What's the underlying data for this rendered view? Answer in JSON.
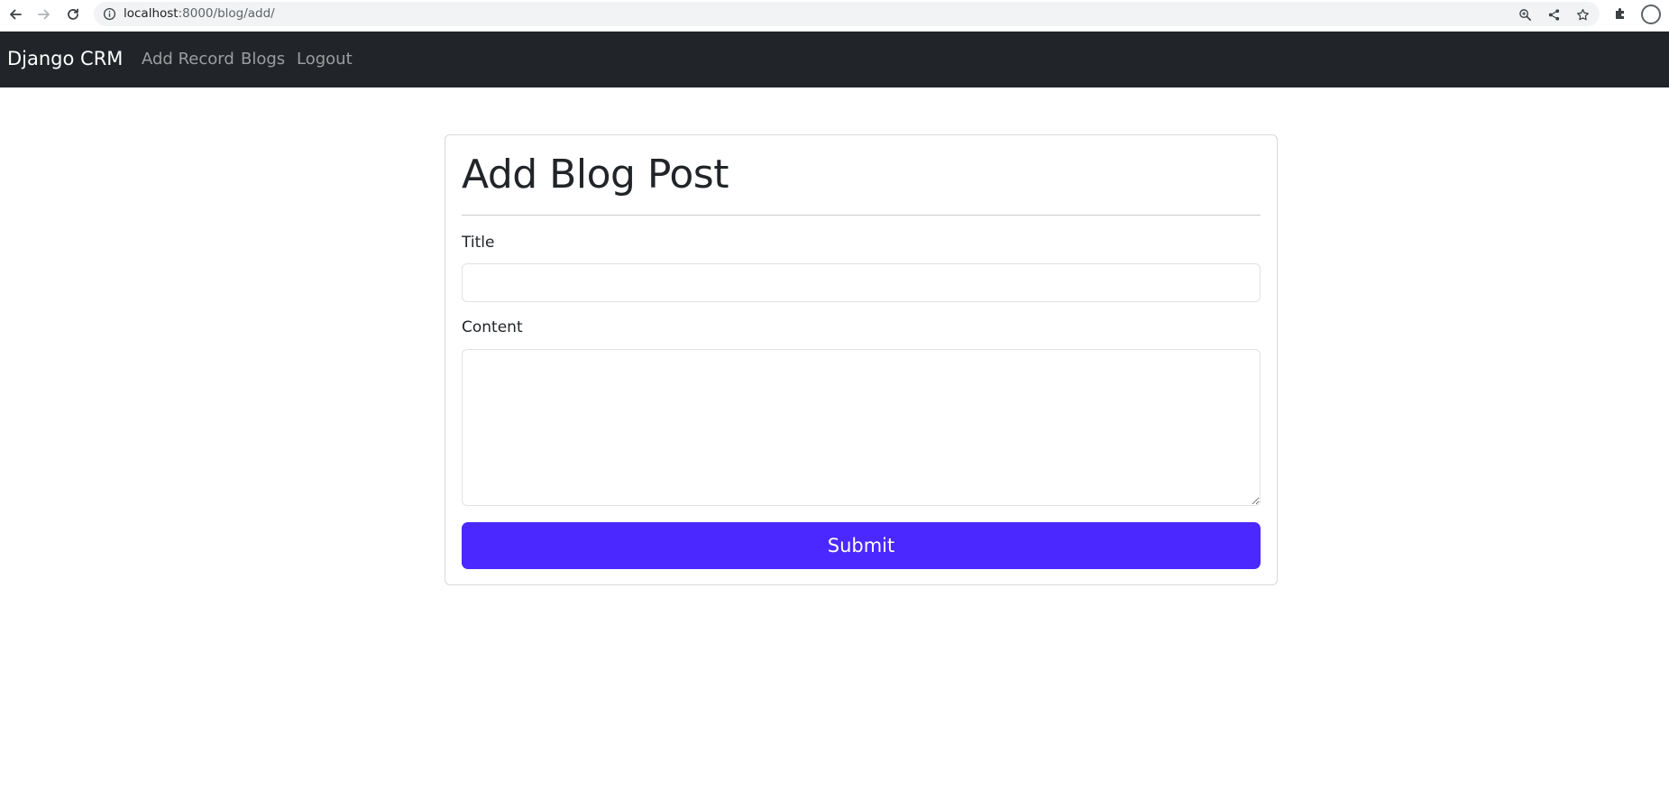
{
  "browser": {
    "url_host": "localhost",
    "url_path": ":8000/blog/add/"
  },
  "navbar": {
    "brand": "Django CRM",
    "links": [
      "Add Record",
      "Blogs",
      "Logout"
    ]
  },
  "form": {
    "heading": "Add Blog Post",
    "title_label": "Title",
    "title_value": "",
    "content_label": "Content",
    "content_value": "",
    "submit_label": "Submit"
  },
  "colors": {
    "navbar_bg": "#212529",
    "submit_bg": "#4b28ff"
  },
  "icons": [
    "back-icon",
    "forward-icon",
    "reload-icon",
    "info-icon",
    "zoom-icon",
    "share-icon",
    "bookmark-star-icon",
    "extensions-icon"
  ]
}
